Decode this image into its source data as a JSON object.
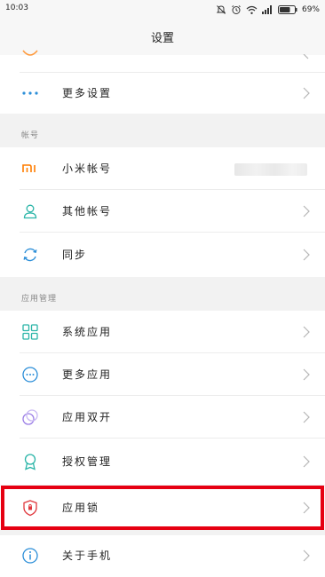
{
  "status_bar": {
    "time": "10:03",
    "battery_percent": "69%",
    "icons": [
      "mute-icon",
      "alarm-icon",
      "wifi-icon",
      "signal-icon",
      "battery-icon"
    ]
  },
  "header": {
    "title": "设置"
  },
  "rows_top": [
    {
      "label": "更多设置",
      "icon": "more-dots-icon"
    }
  ],
  "sections": {
    "accounts": {
      "header": "帐号",
      "items": [
        {
          "label": "小米帐号",
          "icon": "mi-logo-icon"
        },
        {
          "label": "其他帐号",
          "icon": "person-icon"
        },
        {
          "label": "同步",
          "icon": "sync-icon"
        }
      ]
    },
    "apps": {
      "header": "应用管理",
      "items": [
        {
          "label": "系统应用",
          "icon": "grid-icon"
        },
        {
          "label": "更多应用",
          "icon": "circle-dots-icon"
        },
        {
          "label": "应用双开",
          "icon": "dual-circles-icon"
        },
        {
          "label": "授权管理",
          "icon": "badge-icon"
        },
        {
          "label": "应用锁",
          "icon": "shield-lock-icon",
          "highlighted": true
        }
      ]
    },
    "about": {
      "items": [
        {
          "label": "关于手机",
          "icon": "info-icon"
        }
      ]
    }
  },
  "colors": {
    "highlight": "#e60012",
    "mi_orange": "#ff7d00",
    "teal_icon": "#2bb5a8",
    "blue_icon": "#2b8ed8",
    "purple_icon": "#9b7ee6"
  }
}
